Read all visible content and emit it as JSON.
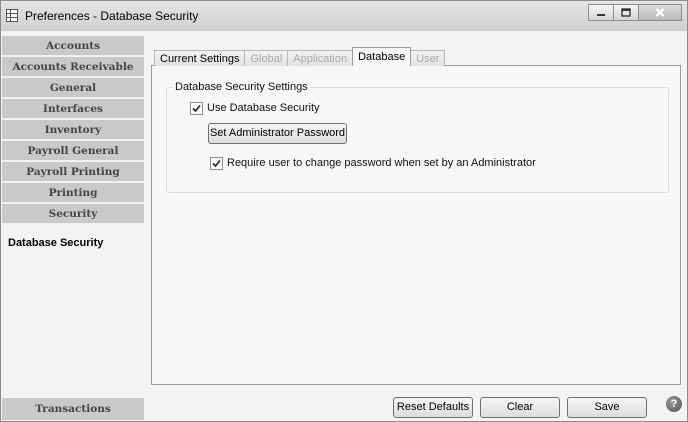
{
  "window": {
    "title": "Preferences - Database Security"
  },
  "sidebar": {
    "items": [
      {
        "label": "Accounts"
      },
      {
        "label": "Accounts Receivable"
      },
      {
        "label": "General"
      },
      {
        "label": "Interfaces"
      },
      {
        "label": "Inventory"
      },
      {
        "label": "Payroll General"
      },
      {
        "label": "Payroll Printing"
      },
      {
        "label": "Printing"
      },
      {
        "label": "Security"
      }
    ],
    "selected_sub": "Database Security",
    "bottom_item": "Transactions"
  },
  "tabs": [
    {
      "label": "Current Settings",
      "state": "normal"
    },
    {
      "label": "Global",
      "state": "disabled"
    },
    {
      "label": "Application",
      "state": "disabled"
    },
    {
      "label": "Database",
      "state": "active"
    },
    {
      "label": "User",
      "state": "disabled"
    }
  ],
  "group": {
    "legend": "Database Security Settings",
    "use_db_security": {
      "label": "Use Database Security",
      "checked": true
    },
    "set_admin_password_label": "Set Administrator Password",
    "require_change": {
      "label": "Require user to change password when set by an Administrator",
      "checked": true
    }
  },
  "footer": {
    "reset_label": "Reset Defaults",
    "clear_label": "Clear",
    "save_label": "Save",
    "help_glyph": "?"
  },
  "icons": {
    "app": "preferences-grid-icon",
    "minimize": "minimize-icon",
    "maximize": "maximize-icon",
    "close": "close-icon",
    "help": "help-icon"
  }
}
